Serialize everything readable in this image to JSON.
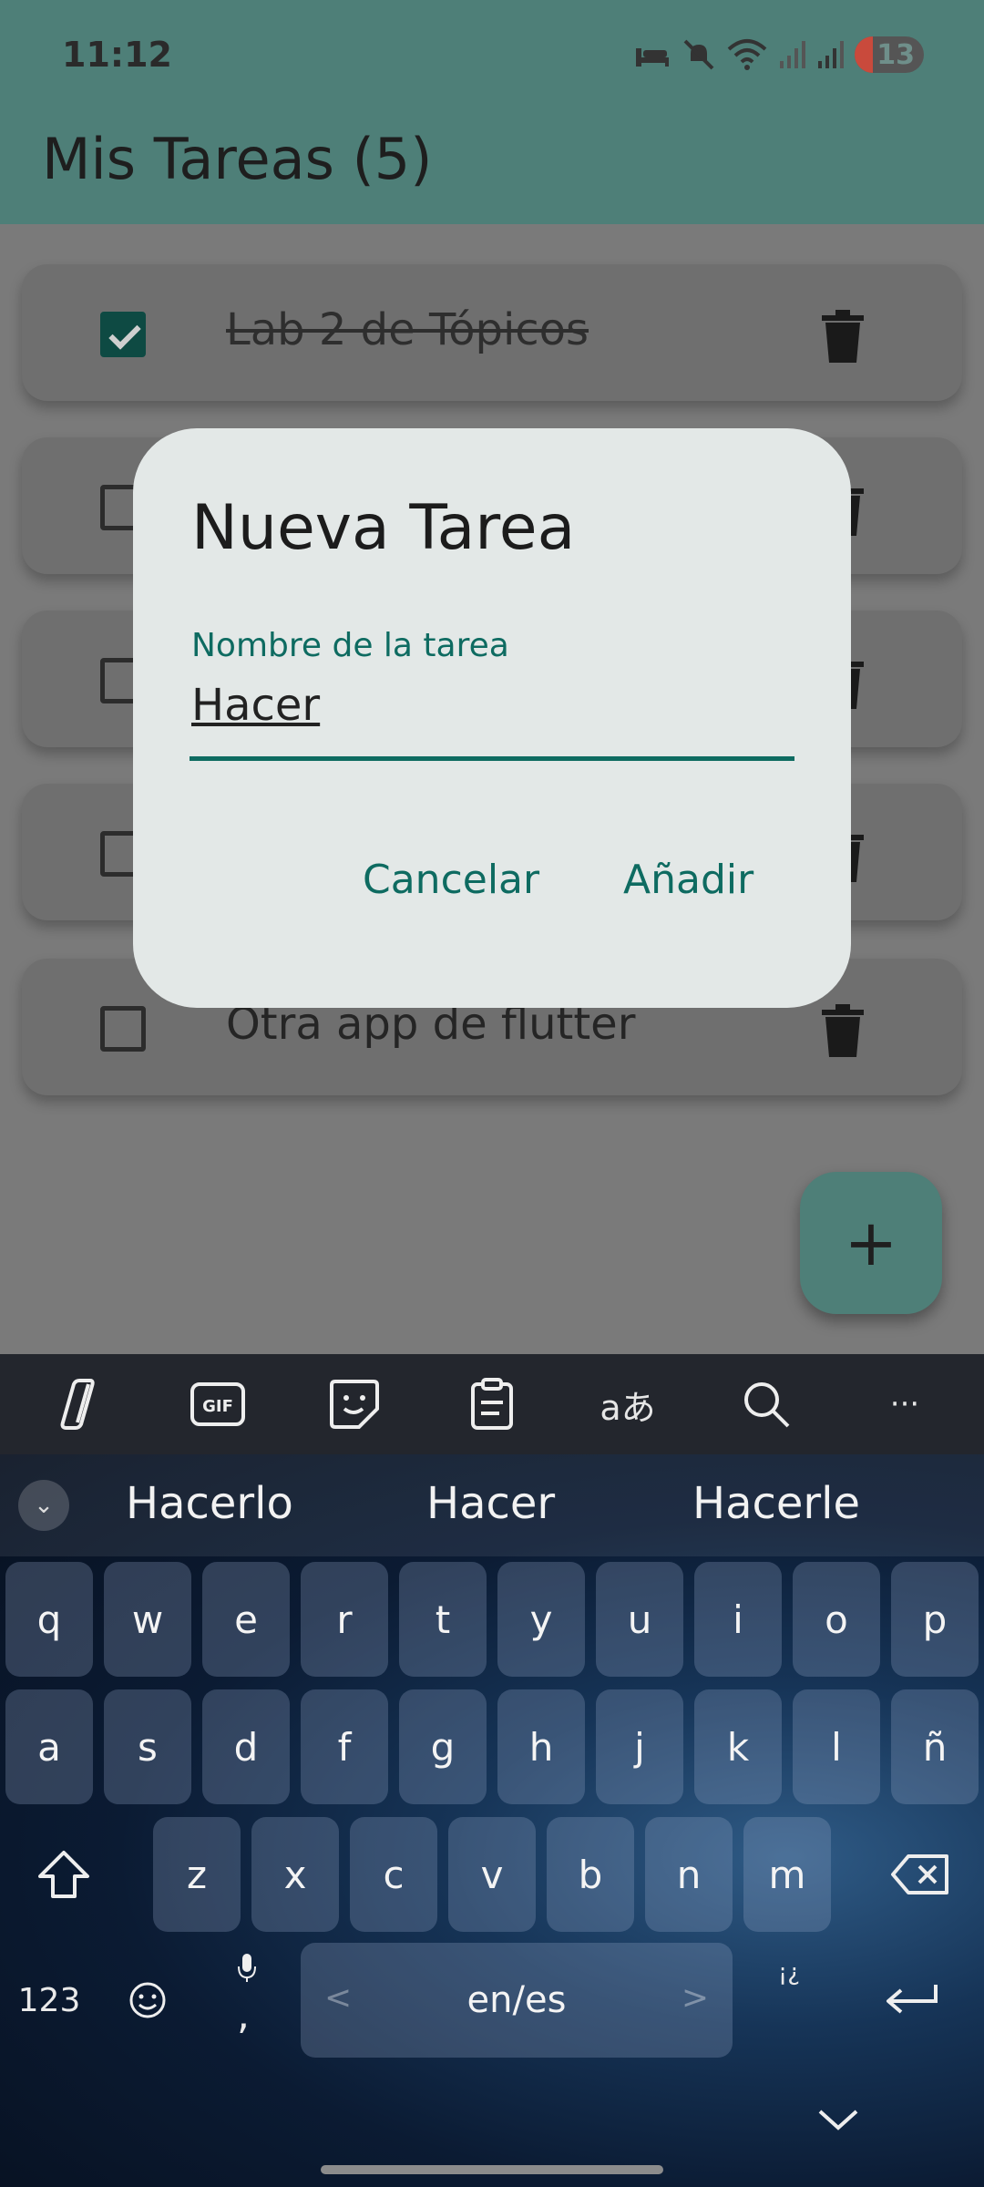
{
  "status_bar": {
    "time": "11:12",
    "battery": "13",
    "icons": [
      "bed-icon",
      "mute-icon",
      "wifi-icon",
      "signal-icon",
      "signal-icon",
      "battery-icon"
    ]
  },
  "app_bar": {
    "title": "Mis Tareas (5)"
  },
  "tasks": [
    {
      "label": "Lab 2 de Tópicos",
      "done": true
    },
    {
      "label": "",
      "done": false
    },
    {
      "label": "",
      "done": false
    },
    {
      "label": "",
      "done": false
    },
    {
      "label": "Otra app de flutter",
      "done": false
    }
  ],
  "dialog": {
    "title": "Nueva Tarea",
    "field_label": "Nombre de la tarea",
    "field_value": "Hacer",
    "cancel_label": "Cancelar",
    "add_label": "Añadir"
  },
  "fab": {
    "icon": "plus-icon",
    "symbol": "+"
  },
  "keyboard": {
    "toolbar": [
      "copilot-icon",
      "gif-icon",
      "sticker-icon",
      "clipboard-icon",
      "translate-icon",
      "search-icon",
      "more-icon"
    ],
    "toolbar_text": {
      "gif": "GIF",
      "translate": "aあ",
      "more": "···"
    },
    "suggestions": [
      "Hacerlo",
      "Hacer",
      "Hacerle"
    ],
    "row1": [
      "q",
      "w",
      "e",
      "r",
      "t",
      "y",
      "u",
      "i",
      "o",
      "p"
    ],
    "row2": [
      "a",
      "s",
      "d",
      "f",
      "g",
      "h",
      "j",
      "k",
      "l",
      "ñ"
    ],
    "row3": [
      "z",
      "x",
      "c",
      "v",
      "b",
      "n",
      "m"
    ],
    "numbers_label": "123",
    "space_label": "en/es",
    "comma": ",",
    "punct": "¡¿",
    "colors": {
      "accent": "#0e6b61",
      "appbar": "#4e7f78"
    }
  }
}
